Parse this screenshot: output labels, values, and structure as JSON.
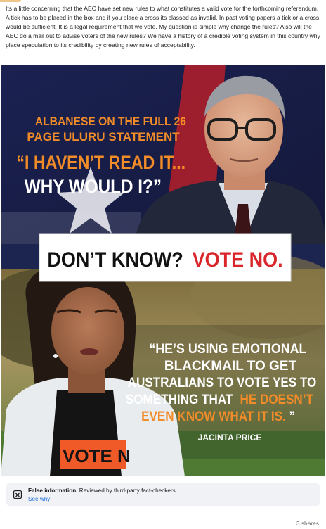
{
  "post": {
    "text": "Its a little concerning that the AEC have set new rules to what constitutes a valid vote for the forthcoming referendum. A tick has to be placed in the box and if you place a cross its classed as invalid. In past voting papers a tick or a cross would be sufficient. It is a legal requirement that we vote. My question is simple why change the rules? Also will the AEC  do a mail out to advise voters of the new rules?  We have a history of a credible voting system in this country why place speculation to its credibility by creating new rules of acceptability."
  },
  "image": {
    "top_line1": "ALBANESE ON THE FULL 26",
    "top_line2": "PAGE ULURU STATEMENT",
    "quote_line1": "“I HAVEN’T READ IT...",
    "quote_line2": "WHY WOULD I?”",
    "banner_black": "DON’T KNOW?",
    "banner_red": "VOTE NO.",
    "quote2_line1": "“HE’S USING EMOTIONAL",
    "quote2_line2": "BLACKMAIL TO GET",
    "quote2_line3": "AUSTRALIANS TO VOTE YES TO",
    "quote2_line4_white": "SOMETHING THAT",
    "quote2_line4_orange": "HE DOESN’T",
    "quote2_line5_orange": "EVEN KNOW WHAT IT IS.",
    "quote2_close": "”",
    "attribution": "JACINTA PRICE",
    "shirt_text": "VOTE N"
  },
  "colors": {
    "accent_orange": "#f28c28",
    "banner_red": "#d9262b",
    "link_blue": "#216fdb",
    "navy": "#1c2450"
  },
  "fact_check": {
    "icon": "fact-check-warning-icon",
    "label_bold": "False information.",
    "label_rest": " Reviewed by third-party fact-checkers.",
    "link": "See why"
  },
  "footer": {
    "shares": "3 shares"
  }
}
